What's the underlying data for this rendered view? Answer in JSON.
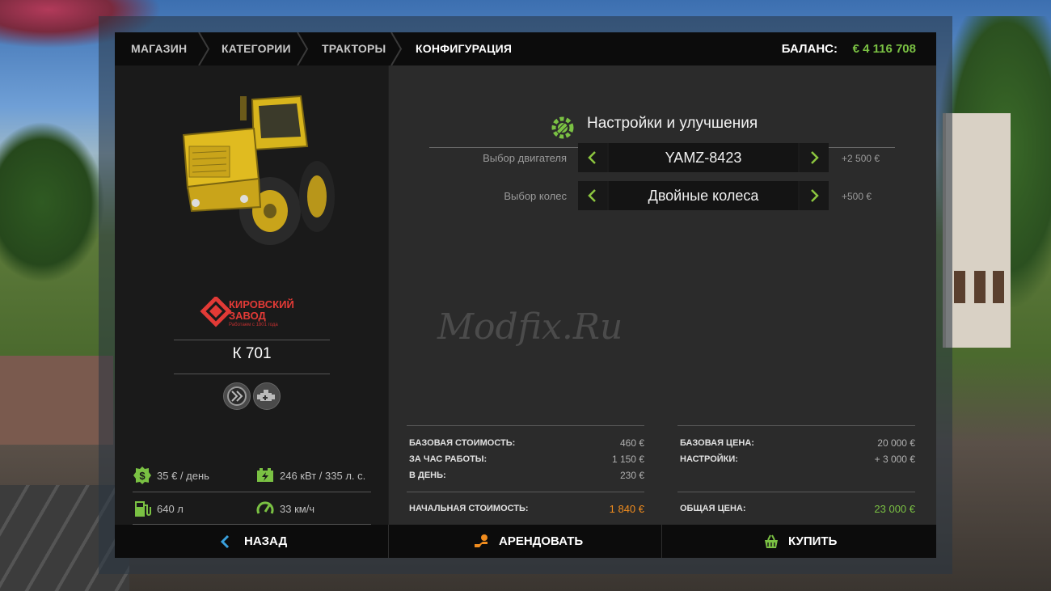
{
  "breadcrumb": [
    "МАГАЗИН",
    "КАТЕГОРИИ",
    "ТРАКТОРЫ",
    "КОНФИГУРАЦИЯ"
  ],
  "balance": {
    "label": "БАЛАНС:",
    "value": "€ 4 116 708"
  },
  "vehicle": {
    "brand_line1": "КИРОВСКИЙ",
    "brand_line2": "ЗАВОД",
    "brand_tagline": "Работаем с 1801 года",
    "model": "К 701",
    "specs": {
      "rent_per_day": "35 € / день",
      "power": "246 кВт / 335 л. с.",
      "fuel": "640 л",
      "speed": "33 км/ч"
    }
  },
  "config": {
    "title": "Настройки и улучшения",
    "options": [
      {
        "label": "Выбор двигателя",
        "value": "YAMZ-8423",
        "price": "+2 500 €"
      },
      {
        "label": "Выбор колес",
        "value": "Двойные колеса",
        "price": "+500 €"
      }
    ],
    "watermark": "Modfix.Ru"
  },
  "costs": {
    "base_cost_label": "БАЗОВАЯ СТОИМОСТЬ:",
    "base_cost": "460 €",
    "per_hour_label": "ЗА ЧАС РАБОТЫ:",
    "per_hour": "1 150 €",
    "per_day_label": "В ДЕНЬ:",
    "per_day": "230 €",
    "initial_label": "НАЧАЛЬНАЯ СТОИМОСТЬ:",
    "initial": "1 840 €",
    "base_price_label": "БАЗОВАЯ ЦЕНА:",
    "base_price": "20 000 €",
    "settings_label": "НАСТРОЙКИ:",
    "settings": "+ 3 000 €",
    "total_label": "ОБЩАЯ ЦЕНА:",
    "total": "23 000 €"
  },
  "actions": {
    "back": "НАЗАД",
    "rent": "АРЕНДОВАТЬ",
    "buy": "КУПИТЬ"
  },
  "colors": {
    "accent_green": "#7ac143",
    "accent_orange": "#f08c1e",
    "brand_red": "#e23a36",
    "arrow_green": "#8cc63f"
  },
  "icons": [
    "chevron-left-icon",
    "chevron-right-icon",
    "wrench-gear-icon",
    "tire-icon",
    "engine-icon",
    "money-icon",
    "battery-icon",
    "fuel-icon",
    "speedometer-icon",
    "hand-coin-icon",
    "basket-icon"
  ]
}
